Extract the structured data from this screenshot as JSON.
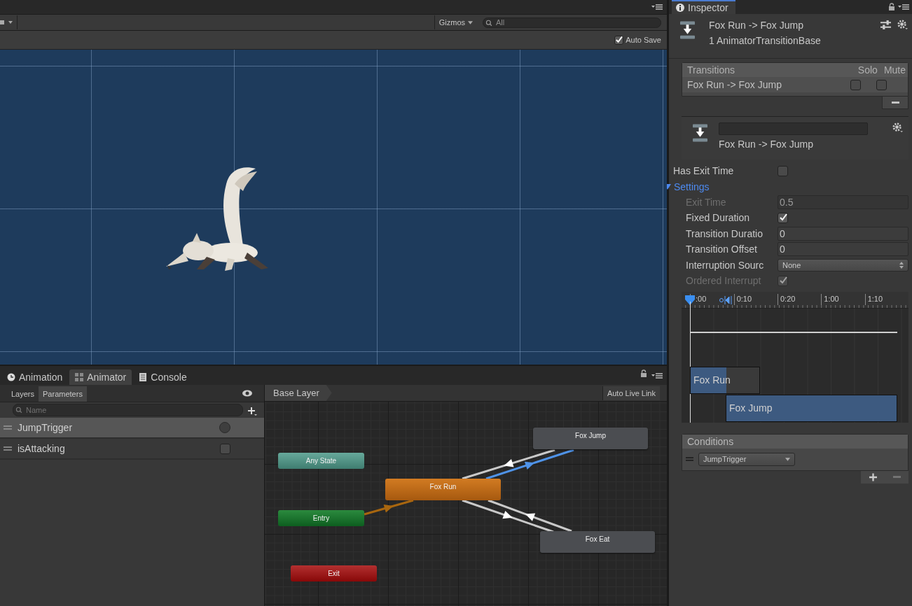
{
  "scene_view": {
    "gizmos": "Gizmos",
    "search_placeholder": "All",
    "auto_save": {
      "label": "Auto Save",
      "checked": true
    }
  },
  "bottom_tabs": [
    {
      "label": "Animation",
      "kind": "animation",
      "selected": false
    },
    {
      "label": "Animator",
      "kind": "animator",
      "selected": true
    },
    {
      "label": "Console",
      "kind": "console",
      "selected": false
    }
  ],
  "animator": {
    "panel_tabs": [
      {
        "label": "Layers",
        "selected": false
      },
      {
        "label": "Parameters",
        "selected": true
      }
    ],
    "search_placeholder": "Name",
    "parameters": [
      {
        "name": "JumpTrigger",
        "kind": "trigger",
        "on": false,
        "selected": true
      },
      {
        "name": "isAttacking",
        "kind": "bool",
        "on": false,
        "selected": false
      }
    ],
    "breadcrumb": "Base Layer",
    "live_link_button": "Auto Live Link",
    "states": [
      {
        "name": "Any State",
        "kind": "any"
      },
      {
        "name": "Entry",
        "kind": "entry"
      },
      {
        "name": "Exit",
        "kind": "exit"
      },
      {
        "name": "Fox Run",
        "kind": "default"
      },
      {
        "name": "Fox Jump",
        "kind": "normal"
      },
      {
        "name": "Fox Eat",
        "kind": "normal"
      }
    ],
    "transitions": [
      {
        "kind": "default",
        "selected": false
      },
      {
        "kind": "normal",
        "selected": false
      },
      {
        "kind": "normal",
        "selected": true
      },
      {
        "kind": "normal",
        "selected": false
      },
      {
        "kind": "normal",
        "selected": false
      }
    ]
  },
  "inspector": {
    "tab": "Inspector",
    "title": "Fox Run -> Fox Jump",
    "subtitle": "1 AnimatorTransitionBase",
    "transitions_list": {
      "header": "Transitions",
      "solo": "Solo",
      "mute": "Mute",
      "rows": [
        {
          "name": "Fox Run -> Fox Jump",
          "solo": false,
          "mute": false
        }
      ]
    },
    "transition": {
      "name": "Fox Run -> Fox Jump"
    },
    "has_exit_time": {
      "label": "Has Exit Time",
      "checked": false
    },
    "settings": {
      "label": "Settings",
      "expanded": true,
      "fields": [
        {
          "kind": "number",
          "label": "Exit Time",
          "value": "0.5",
          "disabled": true
        },
        {
          "kind": "checkbox",
          "label": "Fixed Duration",
          "checked": true,
          "disabled": false
        },
        {
          "kind": "number",
          "label": "Transition Duratio",
          "value": "0",
          "disabled": false
        },
        {
          "kind": "number",
          "label": "Transition Offset",
          "value": "0",
          "disabled": false
        },
        {
          "kind": "dropdown",
          "label": "Interruption Sourc",
          "value": "None",
          "disabled": false
        },
        {
          "kind": "checkbox",
          "label": "Ordered Interrupt",
          "checked": true,
          "disabled": true
        }
      ]
    },
    "timeline": {
      "ticks": [
        ":00",
        "0:10",
        "0:20",
        "1:00",
        "1:10"
      ],
      "clips": [
        {
          "name": "Fox Run"
        },
        {
          "name": "Fox Jump"
        }
      ]
    },
    "conditions": {
      "header": "Conditions",
      "items": [
        {
          "parameter": "JumpTrigger"
        }
      ]
    }
  }
}
